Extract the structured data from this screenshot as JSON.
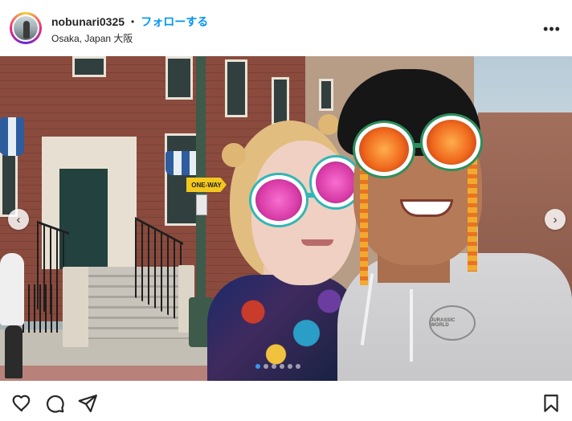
{
  "header": {
    "username": "nobunari0325",
    "separator": "•",
    "follow_label": "フォローする",
    "location": "Osaka, Japan 大阪",
    "more_label": "•••"
  },
  "photo": {
    "street_sign_text": "ONE-WAY",
    "hoodie_logo_text": "JURASSIC WORLD",
    "carousel_dots": 6,
    "active_dot": 0
  },
  "icons": {
    "prev": "chevron-left-icon",
    "next": "chevron-right-icon",
    "like": "heart-icon",
    "comment": "comment-icon",
    "share": "send-icon",
    "save": "bookmark-icon",
    "more": "more-horizontal-icon"
  },
  "colors": {
    "follow": "#0095f6",
    "text": "#262626"
  }
}
